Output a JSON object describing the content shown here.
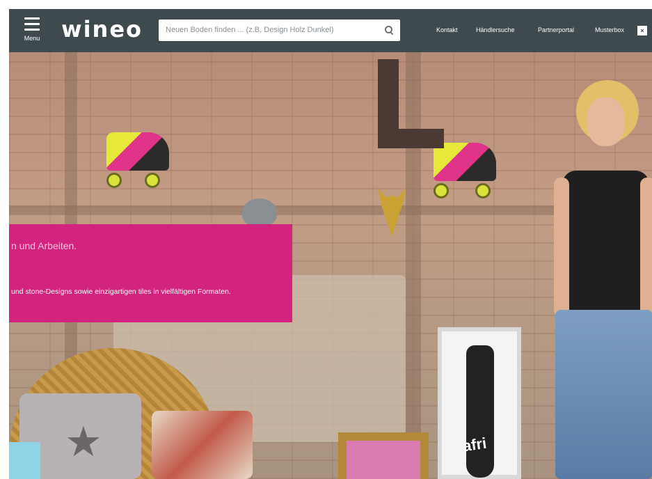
{
  "header": {
    "menu_label": "Menu",
    "logo_text": "wineo",
    "search_placeholder": "Neuen Boden finden ... (z.B. Design Holz Dunkel)",
    "nav": [
      {
        "label": "Kontakt"
      },
      {
        "label": "Händlersuche"
      },
      {
        "label": "Partnerportal"
      },
      {
        "label": "Musterbox"
      }
    ],
    "close_label": "×"
  },
  "hero": {
    "headline": "n und Arbeiten.",
    "description": "und stone-Designs sowie einzigartigen tiles in vielfältigen Formaten.",
    "poster_brand": "afri"
  },
  "colors": {
    "topbar": "#3e4a4e",
    "banner": "#d2237e"
  }
}
